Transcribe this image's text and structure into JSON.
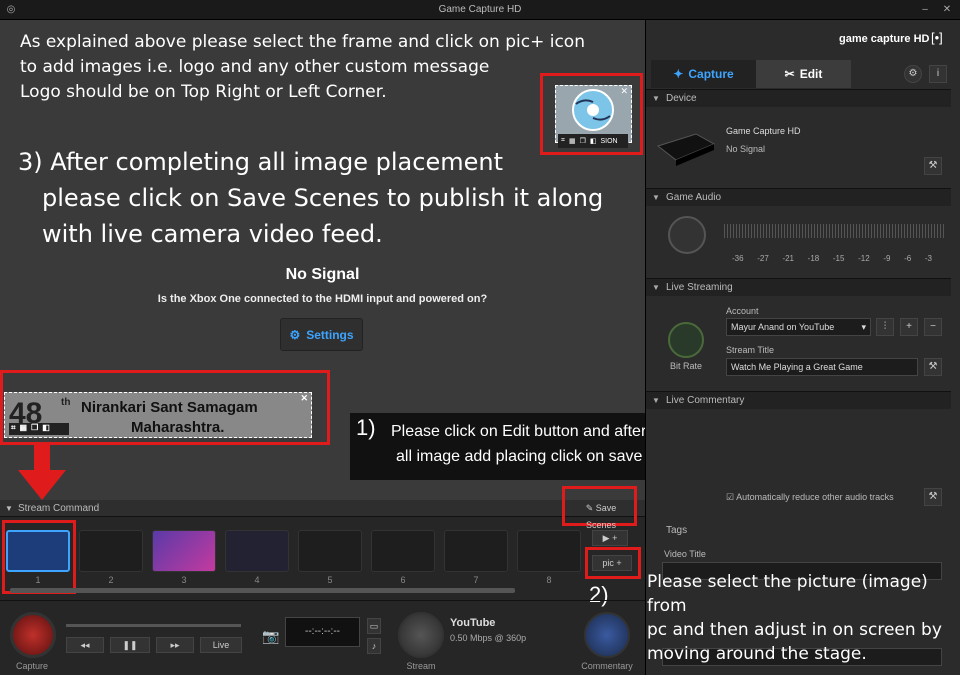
{
  "window": {
    "title": "Game Capture HD"
  },
  "stage": {
    "instructions_top": [
      "As explained above  please select the frame and click on pic+ icon",
      "to add images i.e. logo and any other custom message",
      "Logo should be on Top Right or Left Corner."
    ],
    "step3": [
      "3) After completing all image placement",
      "please click on Save Scenes to publish it along",
      "with live camera video feed."
    ],
    "no_signal": "No Signal",
    "no_signal_sub": "Is the Xbox One connected to the HDMI input and powered on?",
    "settings_label": "Settings",
    "banner_line1": "48",
    "banner_th": "th",
    "banner_line2": "Nirankari Sant Samagam",
    "banner_line3": "Maharashtra.",
    "logo_partial": "SION",
    "step1_num": "1)",
    "step1_text": [
      "Please click on Edit button and after completing",
      "all image add placing click on save to publish it along with video"
    ]
  },
  "sidebar": {
    "brand": "game capture HD",
    "tab_capture": "Capture",
    "tab_edit": "Edit",
    "device_header": "Device",
    "device_name": "Game Capture HD",
    "device_status": "No Signal",
    "audio_header": "Game Audio",
    "audio_ticks": [
      "-36",
      "-27",
      "-21",
      "-18",
      "-15",
      "-12",
      "-9",
      "-6",
      "-3"
    ],
    "live_header": "Live Streaming",
    "account_label": "Account",
    "account_value": "Mayur Anand on YouTube",
    "stream_title_label": "Stream Title",
    "stream_title_value": "Watch Me Playing a Great Game",
    "bitrate_label": "Bit Rate",
    "commentary_header": "Live Commentary",
    "reduce_audio": "Automatically reduce other audio tracks",
    "tags_label": "Tags",
    "video_title_label": "Video Title"
  },
  "bottom": {
    "stream_command": "Stream Command",
    "save_scenes": "Save Scenes",
    "scenes": [
      "1",
      "2",
      "3",
      "4",
      "5",
      "6",
      "7",
      "8"
    ],
    "pic_label": "pic",
    "step2_num": "2)",
    "step2_text": [
      "Please select the picture (image) from",
      "pc and then adjust in on screen by",
      "moving around the stage."
    ],
    "capture_label": "Capture",
    "live_label": "Live",
    "timecode": "--:--:--:--",
    "stream_label": "Stream",
    "youtube_logo": "YouTube",
    "bitrate_info": "0.50 Mbps @ 360p",
    "commentary_label": "Commentary"
  },
  "colors": {
    "accent": "#3da4ff",
    "annotation_red": "#e01b1b",
    "stage_bg": "#3a3a3a"
  }
}
